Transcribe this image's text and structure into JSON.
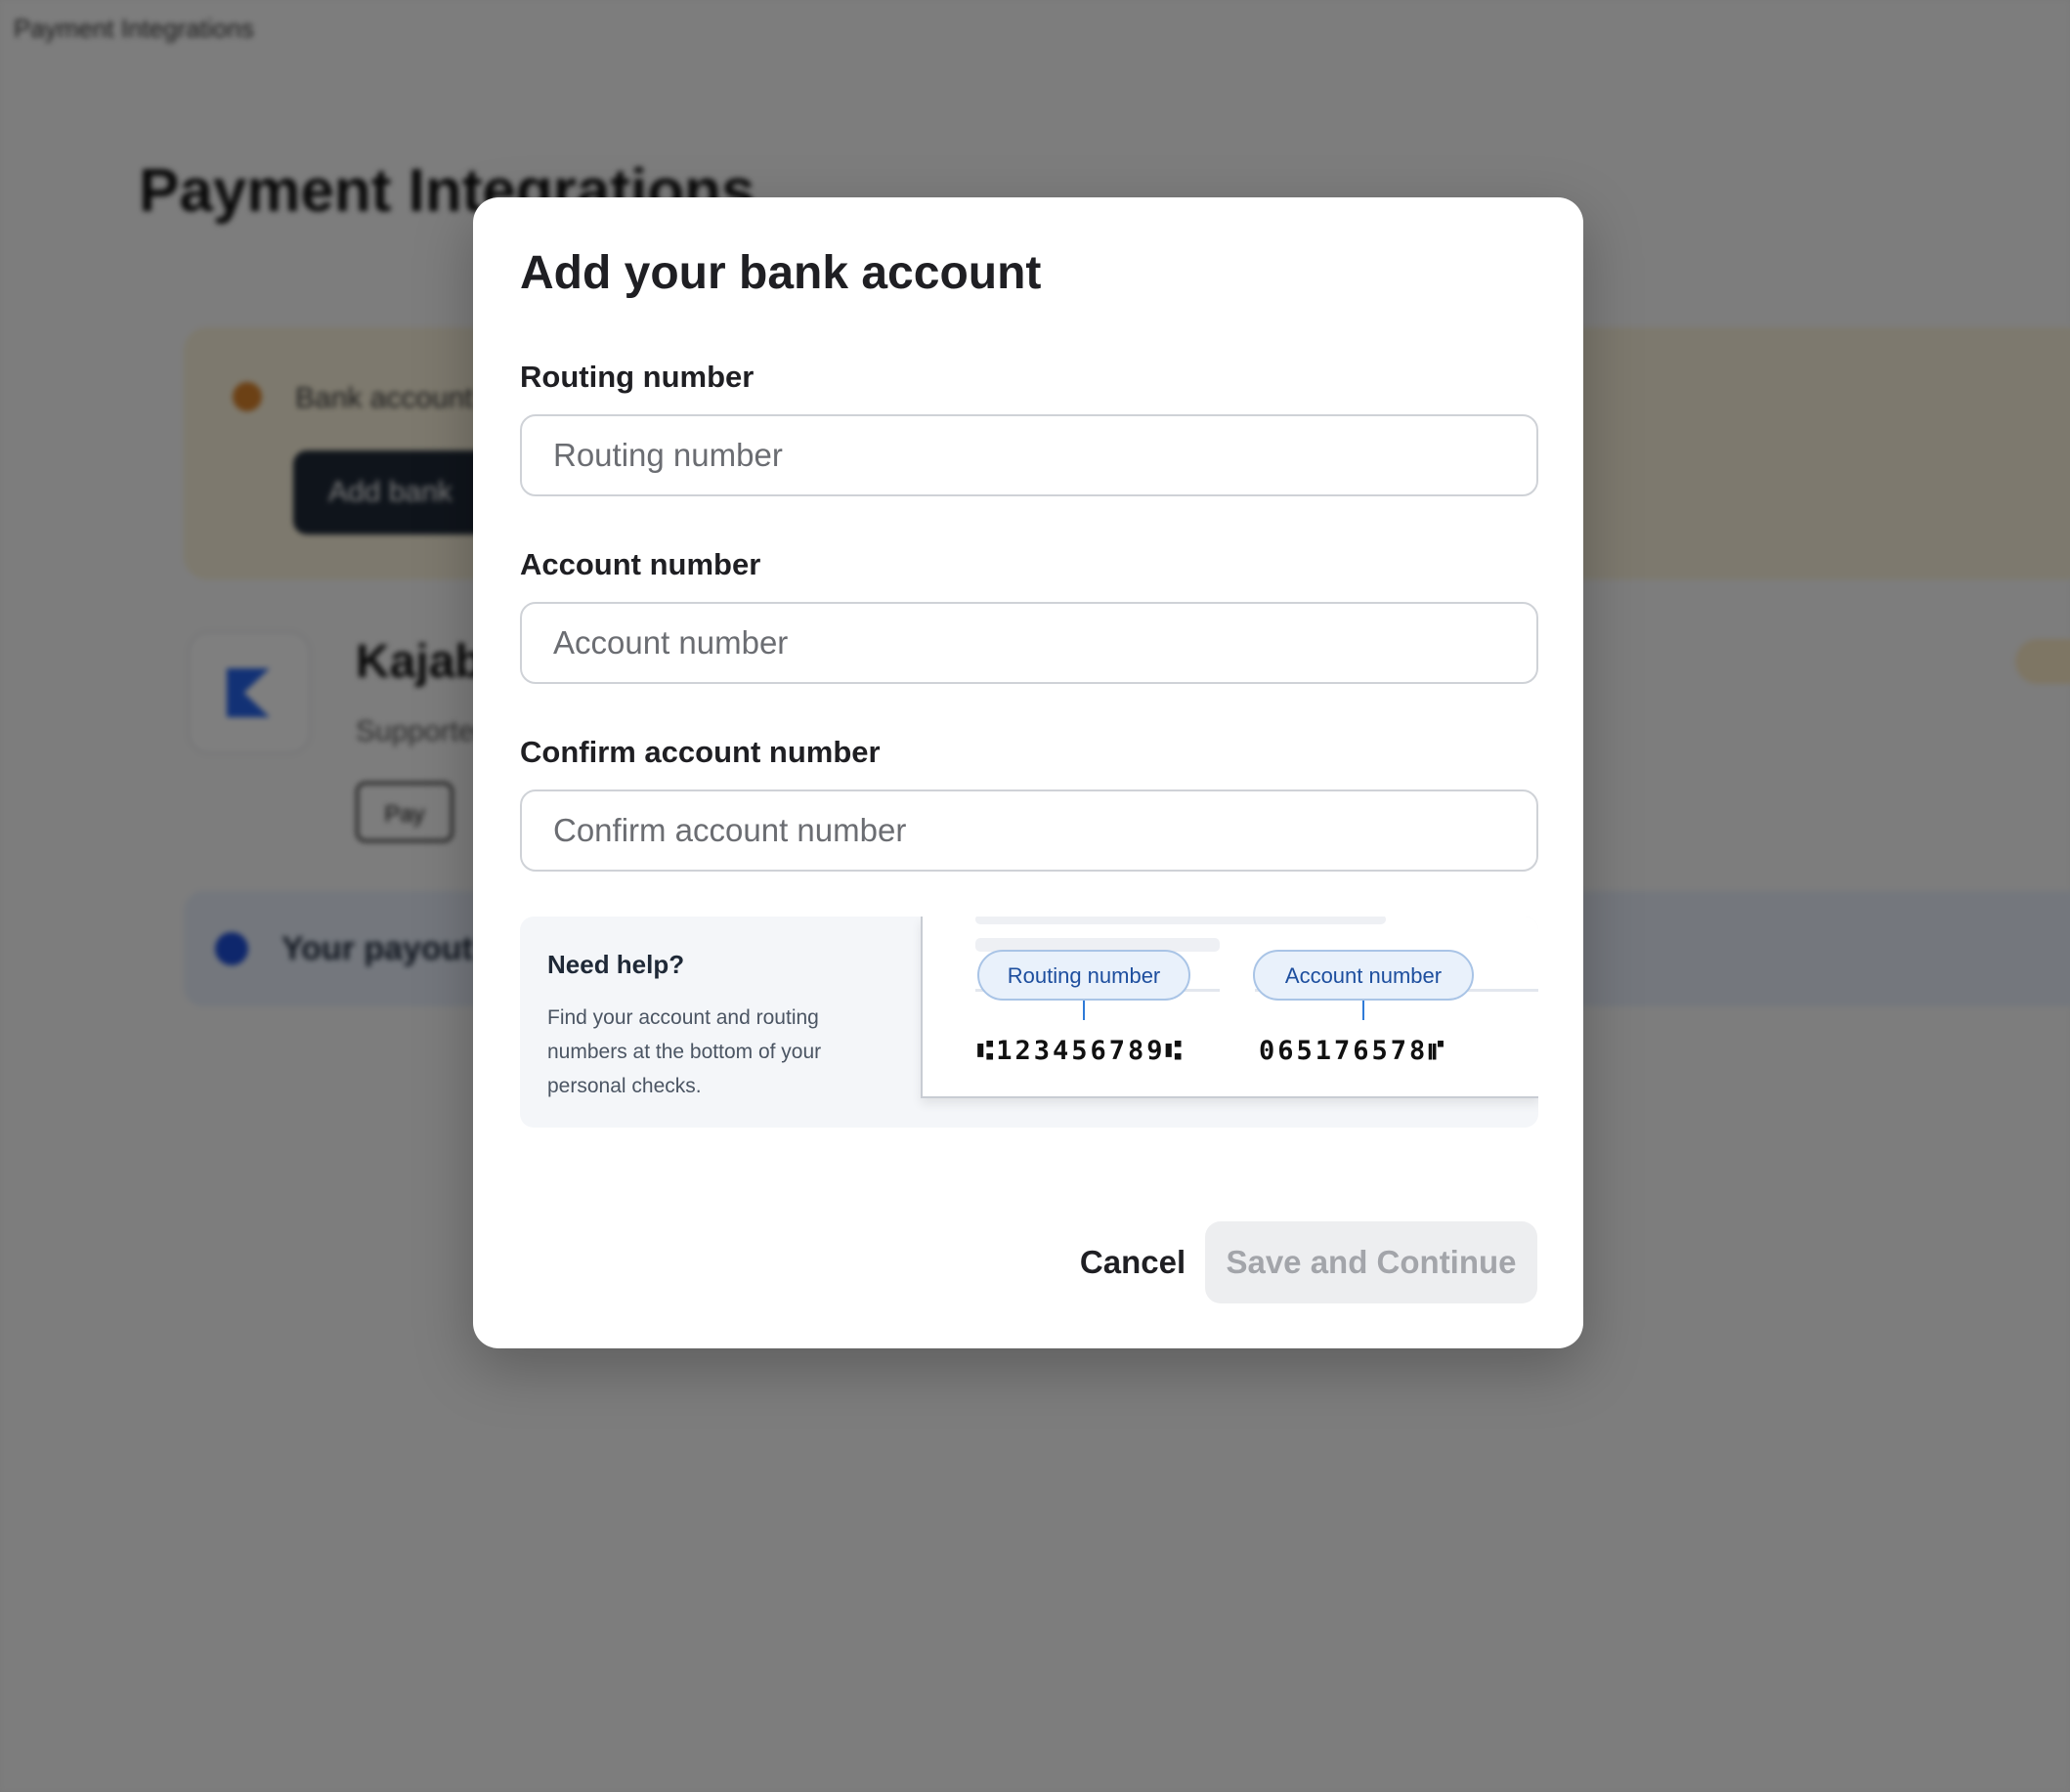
{
  "background": {
    "topbar_title": "Payment Integrations",
    "page_title": "Payment Integrations",
    "banner_text": "Bank account",
    "banner_button": "Add bank",
    "card_title": "Kajabi",
    "card_subtitle": "Supported",
    "card_chip": "Pay",
    "info_text": "Your payout"
  },
  "modal": {
    "title": "Add your bank account",
    "routing": {
      "label": "Routing number",
      "placeholder": "Routing number",
      "value": ""
    },
    "account": {
      "label": "Account number",
      "placeholder": "Account number",
      "value": ""
    },
    "confirm": {
      "label": "Confirm account number",
      "placeholder": "Confirm account number",
      "value": ""
    },
    "help": {
      "title": "Need help?",
      "text": "Find your account and routing numbers at the bottom of your personal checks.",
      "routing_pill": "Routing number",
      "account_pill": "Account number",
      "routing_digits": "⑆123456789⑆",
      "account_digits": "065176578⑈"
    },
    "cancel_label": "Cancel",
    "save_label": "Save and Continue",
    "save_enabled": false
  },
  "colors": {
    "modal_bg": "#ffffff",
    "input_border": "#cfd2d7",
    "disabled_button_bg": "#edeef0",
    "disabled_button_text": "#a3a5aa",
    "pill_bg": "#e9f1fb",
    "pill_text": "#1d4e9e"
  }
}
